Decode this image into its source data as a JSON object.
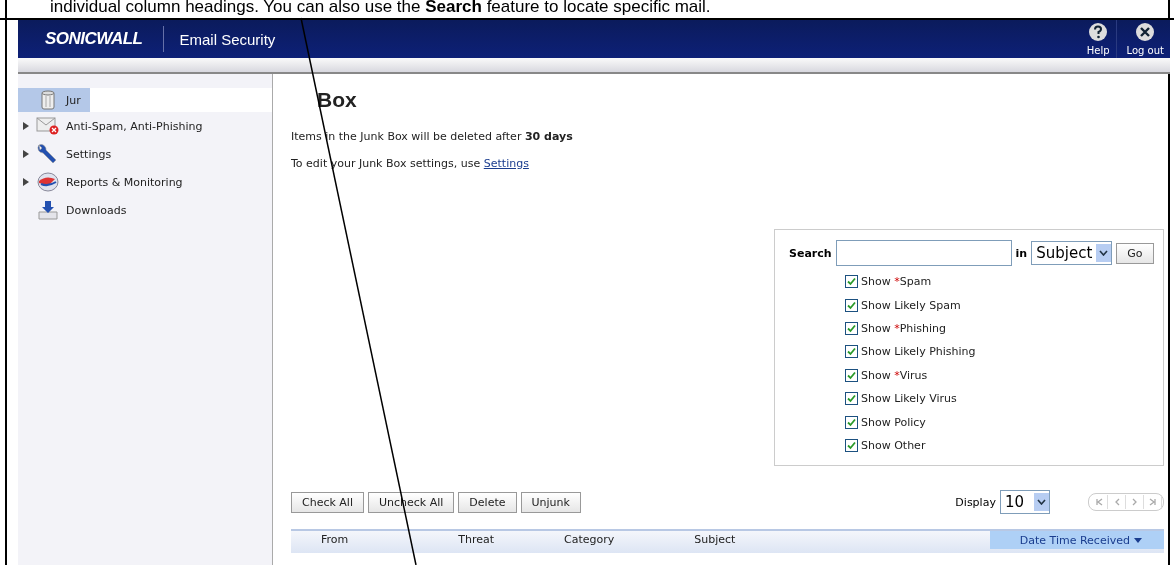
{
  "doc_text": "individual column headings. You can also use the **Search** feature to locate specific mail.",
  "header": {
    "logo": "SONICWALL",
    "product": "Email Security",
    "actions": [
      {
        "kind": "help",
        "label": "Help"
      },
      {
        "kind": "logout",
        "label": "Log out"
      }
    ]
  },
  "sidebar": {
    "items": [
      {
        "label": "Jur",
        "kind": "trash",
        "expandable": false,
        "selected": true
      },
      {
        "label": "Anti-Spam, Anti-Phishing",
        "kind": "mail-blocked",
        "expandable": true,
        "selected": false
      },
      {
        "label": "Settings",
        "kind": "wrench",
        "expandable": true,
        "selected": false
      },
      {
        "label": "Reports & Monitoring",
        "kind": "globe",
        "expandable": true,
        "selected": false
      },
      {
        "label": "Downloads",
        "kind": "download",
        "expandable": false,
        "selected": false
      }
    ]
  },
  "page": {
    "title": "Box",
    "retention_text": "Items in the Junk Box will be deleted after **30 days**",
    "settings_text": "To edit your Junk Box settings, use",
    "settings_link": "Settings"
  },
  "search": {
    "label": "Search",
    "in_label": "in",
    "scope": "Subject",
    "go": "Go",
    "filters": [
      {
        "before": "Show ",
        "star": "*",
        "after": "Spam",
        "checked": true
      },
      {
        "before": "Show Likely Spam",
        "checked": true
      },
      {
        "before": "Show ",
        "star": "*",
        "after": "Phishing",
        "checked": true
      },
      {
        "before": "Show Likely Phishing",
        "checked": true
      },
      {
        "before": "Show ",
        "star": "*",
        "after": "Virus",
        "checked": true
      },
      {
        "before": "Show Likely Virus",
        "checked": true
      },
      {
        "before": "Show Policy",
        "checked": true
      },
      {
        "before": "Show Other",
        "checked": true
      }
    ]
  },
  "actions": [
    "Check All",
    "Uncheck All",
    "Delete",
    "Unjunk"
  ],
  "display": {
    "label": "Display",
    "value": "10"
  },
  "table": {
    "columns": [
      {
        "label": "From",
        "sorted": false
      },
      {
        "label": "Threat",
        "sorted": false
      },
      {
        "label": "Category",
        "sorted": false
      },
      {
        "label": "Subject",
        "sorted": false
      },
      {
        "label": "Date Time Received",
        "sorted": true
      }
    ]
  }
}
